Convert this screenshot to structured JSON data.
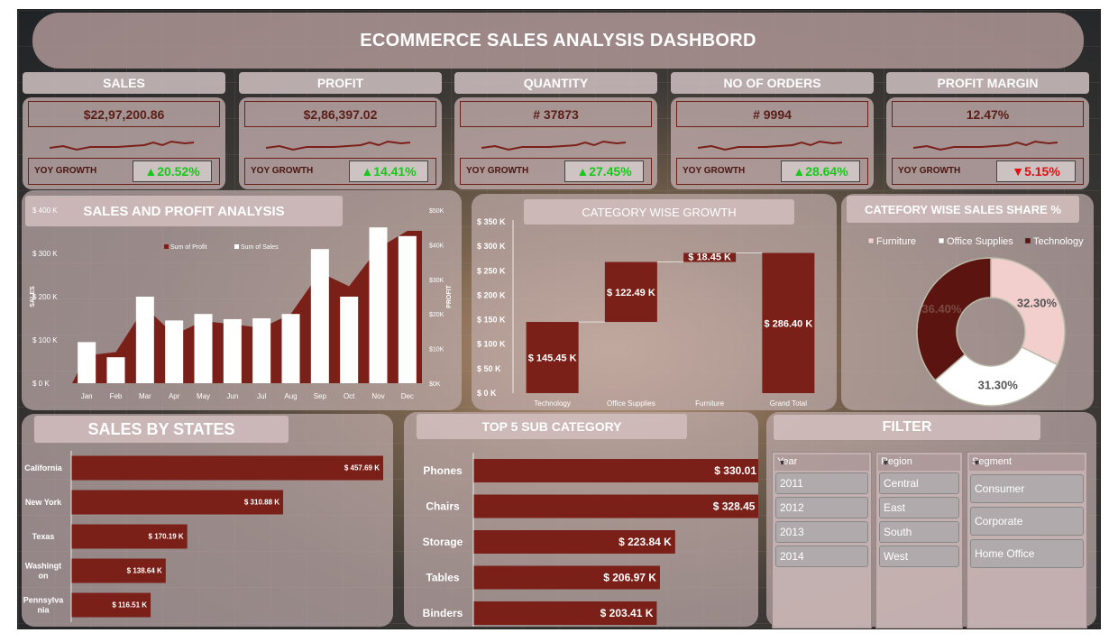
{
  "dashboard": {
    "title": "ECOMMERCE SALES ANALYSIS DASHBORD"
  },
  "kpis": [
    {
      "label": "SALES",
      "value": "$22,97,200.86",
      "growth_label": "YOY GROWTH",
      "growth": "20.52%",
      "direction": "up"
    },
    {
      "label": "PROFIT",
      "value": "$2,86,397.02",
      "growth_label": "YOY GROWTH",
      "growth": "14.41%",
      "direction": "up"
    },
    {
      "label": "QUANTITY",
      "value": "# 37873",
      "growth_label": "YOY GROWTH",
      "growth": "27.45%",
      "direction": "up"
    },
    {
      "label": "NO OF ORDERS",
      "value": "# 9994",
      "growth_label": "YOY GROWTH",
      "growth": "28.64%",
      "direction": "up"
    },
    {
      "label": "PROFIT MARGIN",
      "value": "12.47%",
      "growth_label": "YOY GROWTH",
      "growth": "5.15%",
      "direction": "down"
    }
  ],
  "icons": {
    "up": "triangle-up-icon",
    "down": "triangle-down-icon",
    "multiselect": "multi-select-icon",
    "clear_filter": "clear-filter-icon"
  },
  "colors": {
    "bar": "#7a2018",
    "sales_bar": "#ffffff",
    "pie_furniture": "#f2cfcc",
    "pie_office": "#ffffff",
    "pie_technology": "#5c1410",
    "up": "#18c818",
    "down": "#e01010"
  },
  "chart_data": [
    {
      "type": "bar",
      "title": "SALES AND PROFIT ANALYSIS",
      "categories": [
        "Jan",
        "Feb",
        "Mar",
        "Apr",
        "May",
        "Jun",
        "Jul",
        "Aug",
        "Sep",
        "Oct",
        "Nov",
        "Dec"
      ],
      "series": [
        {
          "name": "Sum of Sales",
          "values": [
            95,
            60,
            200,
            145,
            160,
            148,
            150,
            160,
            310,
            200,
            360,
            340
          ],
          "axis": "left"
        },
        {
          "name": "Sum of Profit",
          "values": [
            8,
            9,
            22,
            14,
            18,
            17,
            16,
            20,
            32,
            28,
            39,
            44
          ],
          "axis": "right",
          "type": "area"
        }
      ],
      "xlabel": "",
      "ylabel": "SALES",
      "ylabel_right": "PROFIT",
      "ylim": [
        0,
        400
      ],
      "ylim_right": [
        0,
        50
      ],
      "yticks": [
        "$ 0 K",
        "$ 100 K",
        "$ 200 K",
        "$ 300 K",
        "$ 400 K"
      ],
      "yticks_right": [
        "$0K",
        "$10K",
        "$20K",
        "$30K",
        "$40K",
        "$50K"
      ],
      "legend": "top-center"
    },
    {
      "type": "bar",
      "title": "CATEGORY WISE GROWTH",
      "subtype": "waterfall",
      "categories": [
        "Technology",
        "Office Supplies",
        "Furniture",
        "Grand Total"
      ],
      "values": [
        145.45,
        122.49,
        18.45,
        286.4
      ],
      "labels": [
        "$ 145.45 K",
        "$ 122.49 K",
        "$ 18.45 K",
        "$ 286.40 K"
      ],
      "ylim": [
        0,
        350
      ],
      "yticks": [
        "$ 0 K",
        "$ 50 K",
        "$ 100 K",
        "$ 150 K",
        "$ 200 K",
        "$ 250 K",
        "$ 300 K",
        "$ 350 K"
      ]
    },
    {
      "type": "pie",
      "title": "CATEFORY WISE SALES SHARE %",
      "categories": [
        "Furniture",
        "Office Supplies",
        "Technology"
      ],
      "values": [
        32.3,
        31.3,
        36.4
      ],
      "labels": [
        "32.30%",
        "31.30%",
        "36.40%"
      ],
      "legend": "top"
    },
    {
      "type": "bar",
      "orientation": "horizontal",
      "title": "SALES BY STATES",
      "categories": [
        "California",
        "New York",
        "Texas",
        "Washington",
        "Pennsylvania"
      ],
      "category_labels": [
        [
          "California"
        ],
        [
          "New York"
        ],
        [
          "Texas"
        ],
        [
          "Washingt",
          "on"
        ],
        [
          "Pennsylva",
          "nia"
        ]
      ],
      "values": [
        457.69,
        310.88,
        170.19,
        138.64,
        116.51
      ],
      "labels": [
        "$ 457.69 K",
        "$ 310.88 K",
        "$ 170.19 K",
        "$ 138.64 K",
        "$ 116.51 K"
      ]
    },
    {
      "type": "bar",
      "orientation": "horizontal",
      "title": "TOP 5 SUB CATEGORY",
      "categories": [
        "Phones",
        "Chairs",
        "Storage",
        "Tables",
        "Binders"
      ],
      "values": [
        330.01,
        328.45,
        223.84,
        206.97,
        203.41
      ],
      "labels": [
        "$ 330.01 K",
        "$ 328.45 K",
        "$ 223.84 K",
        "$ 206.97 K",
        "$ 203.41 K"
      ]
    }
  ],
  "filter": {
    "title": "FILTER",
    "slicers": [
      {
        "title": "Year",
        "items": [
          "2011",
          "2012",
          "2013",
          "2014"
        ]
      },
      {
        "title": "Region",
        "items": [
          "Central",
          "East",
          "South",
          "West"
        ]
      },
      {
        "title": "Segment",
        "items": [
          "Consumer",
          "Corporate",
          "Home Office"
        ]
      }
    ]
  }
}
